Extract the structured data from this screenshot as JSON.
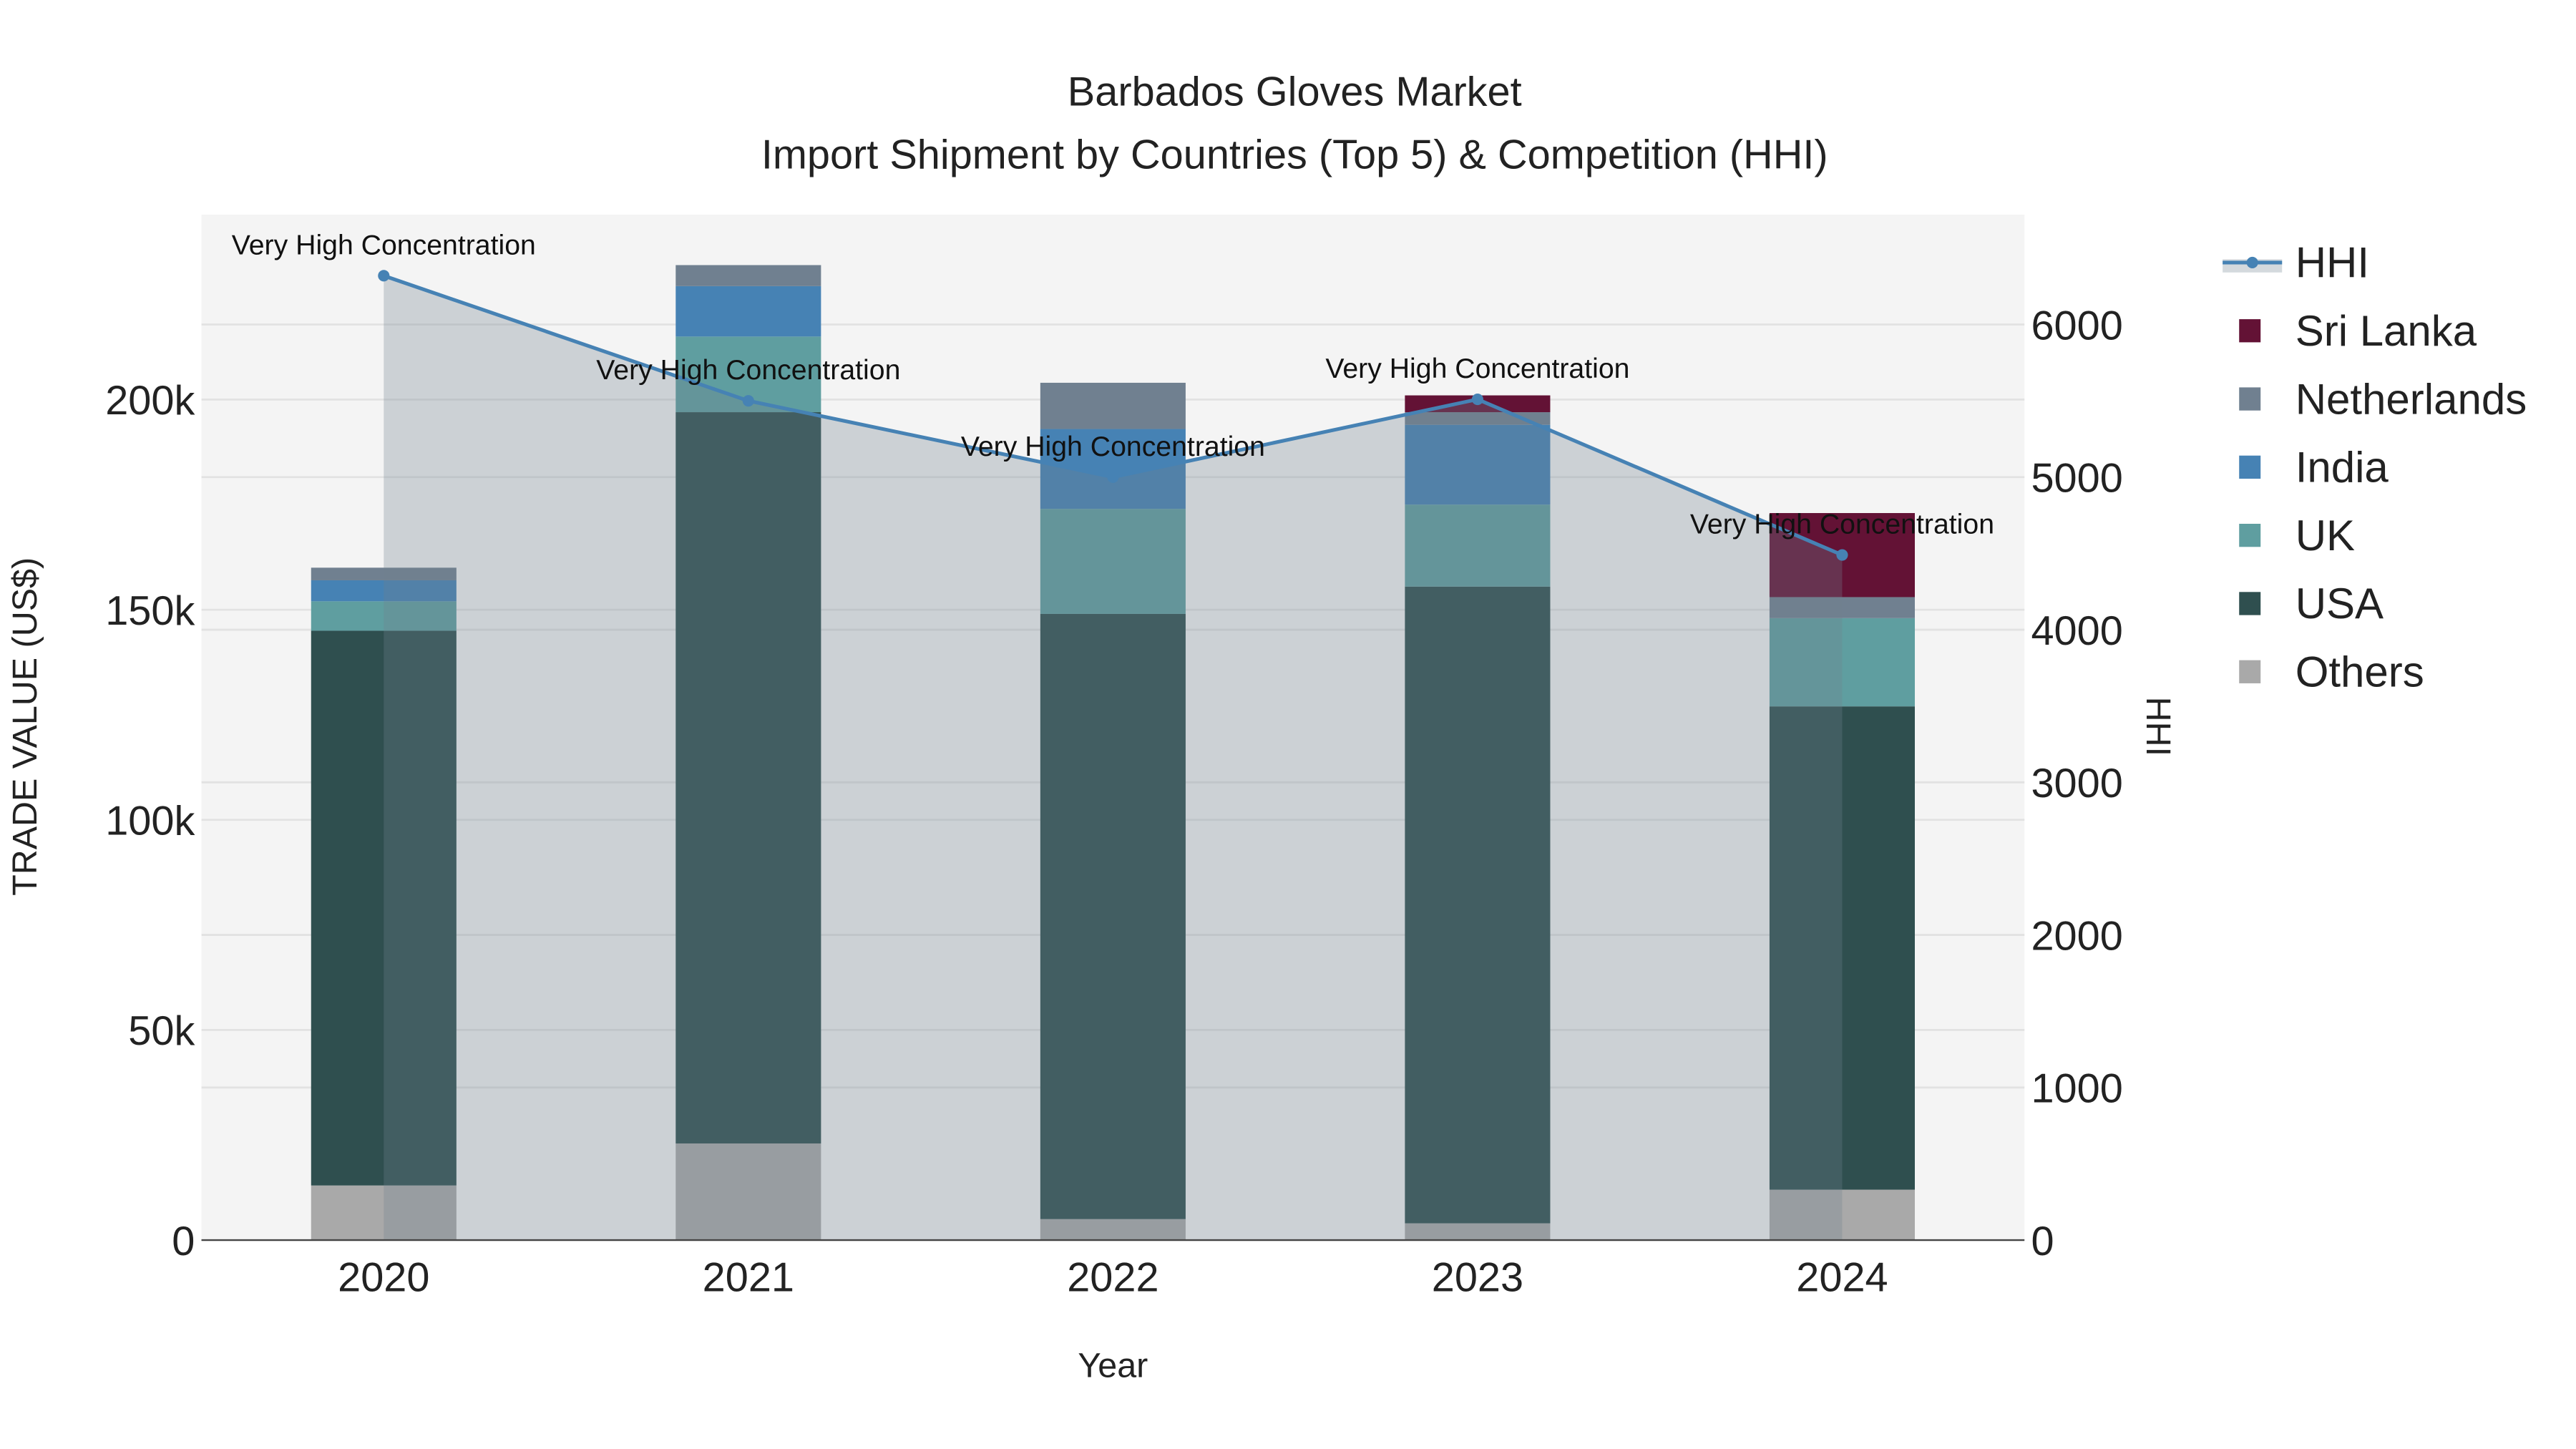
{
  "chart_data": {
    "type": "bar",
    "title": "Barbados Gloves Market",
    "subtitle": "Import Shipment by Countries (Top 5) & Competition (HHI)",
    "xlabel": "Year",
    "ylabel": "TRADE VALUE (US$)",
    "y2label": "HHI",
    "categories": [
      "2020",
      "2021",
      "2022",
      "2023",
      "2024"
    ],
    "ylim": [
      0,
      244000
    ],
    "y2lim": [
      0,
      6720
    ],
    "yticks": [
      0,
      50000,
      100000,
      150000,
      200000
    ],
    "ytick_labels": [
      "0",
      "50k",
      "100k",
      "150k",
      "200k"
    ],
    "y2ticks": [
      0,
      1000,
      2000,
      3000,
      4000,
      5000,
      6000
    ],
    "y2tick_labels": [
      "0",
      "1000",
      "2000",
      "3000",
      "4000",
      "5000",
      "6000"
    ],
    "grid": true,
    "legend_position": "right",
    "series": [
      {
        "name": "Others",
        "color": "#a9a9a9",
        "values": [
          13000,
          23000,
          5000,
          4000,
          12000
        ]
      },
      {
        "name": "USA",
        "color": "#2f4f4f",
        "values": [
          132000,
          174000,
          144000,
          151500,
          115000
        ]
      },
      {
        "name": "UK",
        "color": "#5f9ea0",
        "values": [
          7000,
          18000,
          25000,
          19500,
          21000
        ]
      },
      {
        "name": "India",
        "color": "#4682b4",
        "values": [
          5000,
          12000,
          19000,
          19000,
          0
        ]
      },
      {
        "name": "Netherlands",
        "color": "#708090",
        "values": [
          3000,
          5000,
          11000,
          3000,
          5000
        ]
      },
      {
        "name": "Sri Lanka",
        "color": "#631235",
        "values": [
          0,
          0,
          0,
          4000,
          20000
        ]
      }
    ],
    "hhi": {
      "name": "HHI",
      "color": "#4682b4",
      "values": [
        6320,
        5500,
        5000,
        5510,
        4490
      ],
      "annotations": [
        "Very High Concentration",
        "Very High Concentration",
        "Very High Concentration",
        "Very High Concentration",
        "Very High Concentration"
      ]
    },
    "legend": [
      "HHI",
      "Sri Lanka",
      "Netherlands",
      "India",
      "UK",
      "USA",
      "Others"
    ]
  }
}
